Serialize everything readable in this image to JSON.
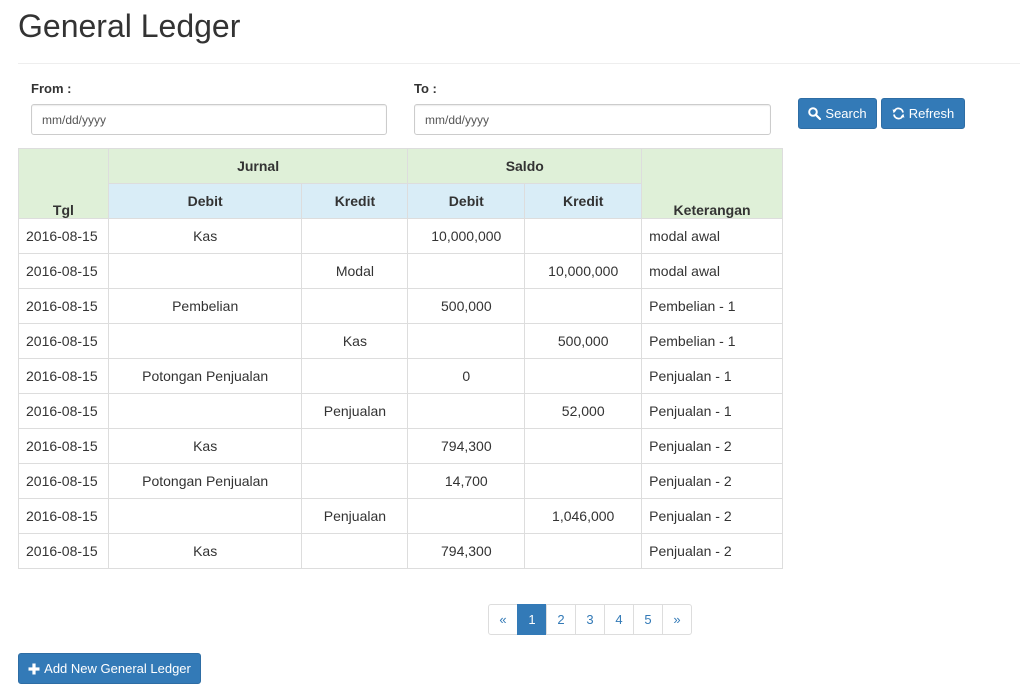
{
  "page": {
    "title": "General Ledger"
  },
  "filters": {
    "from_label": "From :",
    "to_label": "To :",
    "from_placeholder": "mm/dd/yyyy",
    "to_placeholder": "mm/dd/yyyy",
    "search_label": "Search",
    "refresh_label": "Refresh"
  },
  "table": {
    "headers": {
      "tgl": "Tgl",
      "jurnal": "Jurnal",
      "saldo": "Saldo",
      "keterangan": "Keterangan",
      "debit": "Debit",
      "kredit": "Kredit"
    },
    "rows": [
      {
        "tgl": "2016-08-15",
        "jurnal_debit": "Kas",
        "jurnal_kredit": "",
        "saldo_debit": "10,000,000",
        "saldo_kredit": "",
        "keterangan": "modal awal"
      },
      {
        "tgl": "2016-08-15",
        "jurnal_debit": "",
        "jurnal_kredit": "Modal",
        "saldo_debit": "",
        "saldo_kredit": "10,000,000",
        "keterangan": "modal awal"
      },
      {
        "tgl": "2016-08-15",
        "jurnal_debit": "Pembelian",
        "jurnal_kredit": "",
        "saldo_debit": "500,000",
        "saldo_kredit": "",
        "keterangan": "Pembelian - 1"
      },
      {
        "tgl": "2016-08-15",
        "jurnal_debit": "",
        "jurnal_kredit": "Kas",
        "saldo_debit": "",
        "saldo_kredit": "500,000",
        "keterangan": "Pembelian - 1"
      },
      {
        "tgl": "2016-08-15",
        "jurnal_debit": "Potongan Penjualan",
        "jurnal_kredit": "",
        "saldo_debit": "0",
        "saldo_kredit": "",
        "keterangan": "Penjualan - 1"
      },
      {
        "tgl": "2016-08-15",
        "jurnal_debit": "",
        "jurnal_kredit": "Penjualan",
        "saldo_debit": "",
        "saldo_kredit": "52,000",
        "keterangan": "Penjualan - 1"
      },
      {
        "tgl": "2016-08-15",
        "jurnal_debit": "Kas",
        "jurnal_kredit": "",
        "saldo_debit": "794,300",
        "saldo_kredit": "",
        "keterangan": "Penjualan - 2"
      },
      {
        "tgl": "2016-08-15",
        "jurnal_debit": "Potongan Penjualan",
        "jurnal_kredit": "",
        "saldo_debit": "14,700",
        "saldo_kredit": "",
        "keterangan": "Penjualan - 2"
      },
      {
        "tgl": "2016-08-15",
        "jurnal_debit": "",
        "jurnal_kredit": "Penjualan",
        "saldo_debit": "",
        "saldo_kredit": "1,046,000",
        "keterangan": "Penjualan - 2"
      },
      {
        "tgl": "2016-08-15",
        "jurnal_debit": "Kas",
        "jurnal_kredit": "",
        "saldo_debit": "794,300",
        "saldo_kredit": "",
        "keterangan": "Penjualan - 2"
      }
    ]
  },
  "pagination": {
    "prev": "«",
    "pages": [
      "1",
      "2",
      "3",
      "4",
      "5"
    ],
    "active_page": "1",
    "next": "»"
  },
  "actions": {
    "add_label": "Add New General Ledger"
  },
  "icons": {
    "search": "search-icon",
    "refresh": "refresh-icon",
    "add": "plus-icon"
  },
  "colors": {
    "primary": "#337ab7",
    "header_green": "#dff0d8",
    "header_blue": "#d9edf7",
    "border": "#dddddd"
  }
}
